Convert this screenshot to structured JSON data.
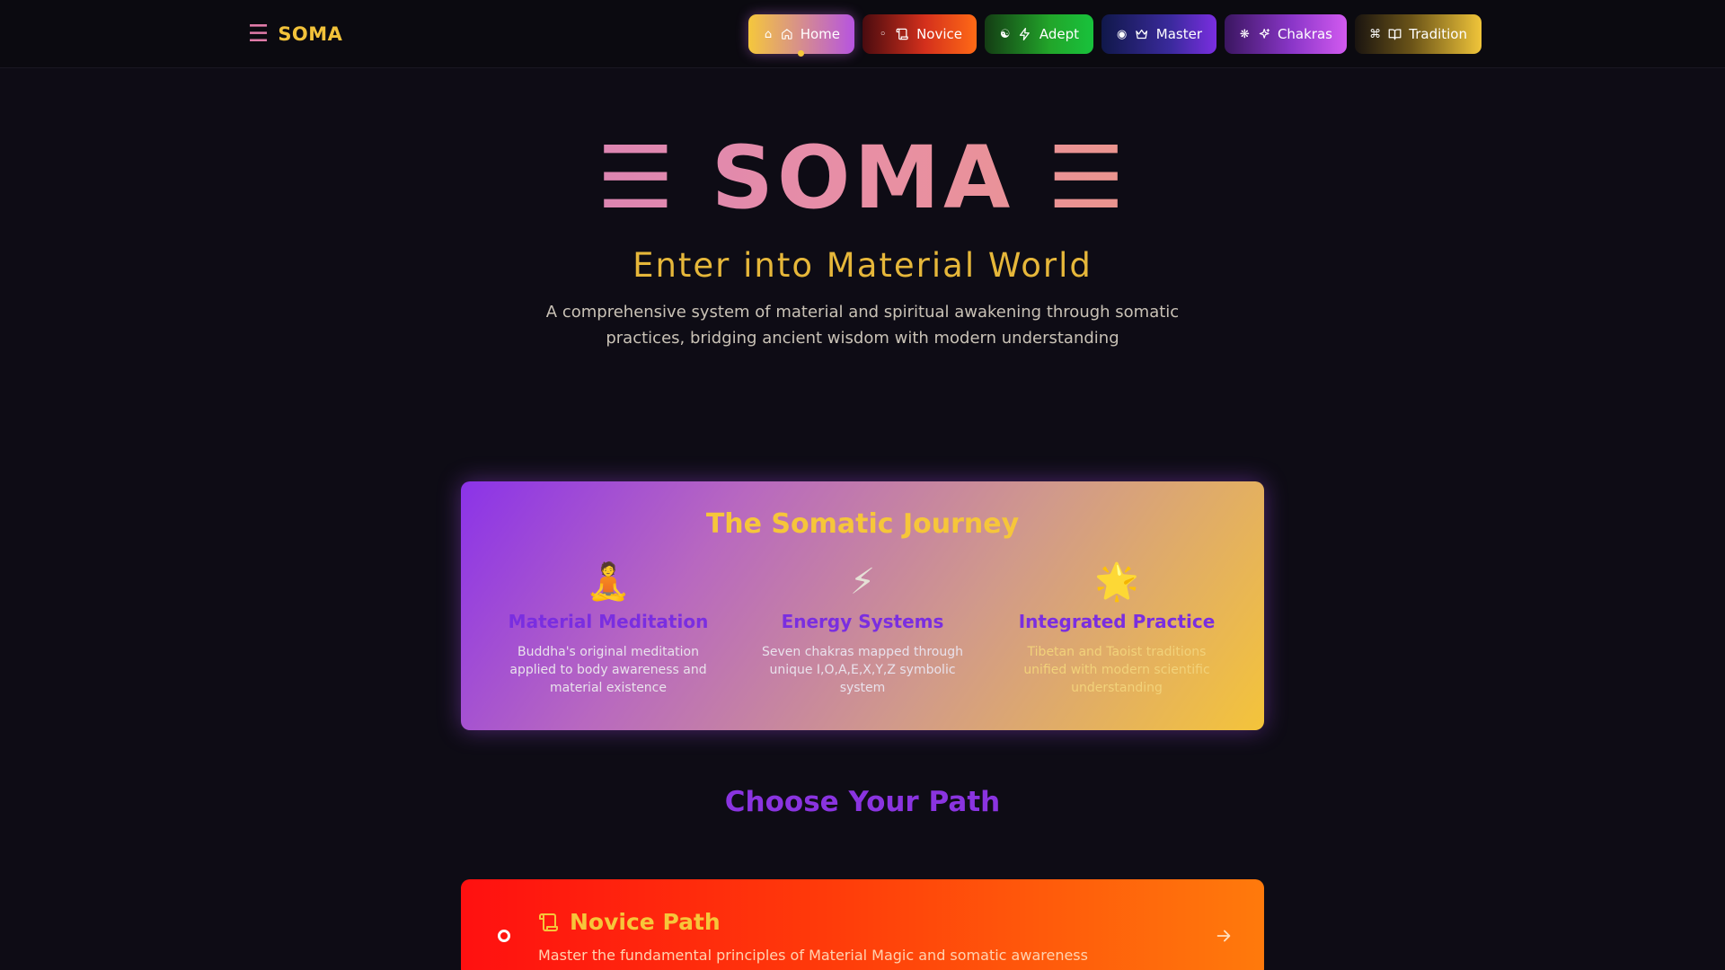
{
  "header": {
    "brand_icon": "☰",
    "brand_name": "SOMA",
    "nav": [
      {
        "symbol": "⌂",
        "icon": "home-icon",
        "label": "Home",
        "active": true
      },
      {
        "symbol": "◦",
        "icon": "scroll-icon",
        "label": "Novice"
      },
      {
        "symbol": "☯",
        "icon": "zap-icon",
        "label": "Adept"
      },
      {
        "symbol": "◉",
        "icon": "crown-icon",
        "label": "Master"
      },
      {
        "symbol": "❋",
        "icon": "sparkles-icon",
        "label": "Chakras"
      },
      {
        "symbol": "⌘",
        "icon": "book-open-icon",
        "label": "Tradition"
      }
    ]
  },
  "hero": {
    "title": "☰ SOMA ☰",
    "subtitle": "Enter into Material World",
    "description": "A comprehensive system of material and spiritual awakening through somatic practices, bridging ancient wisdom with modern understanding"
  },
  "journey": {
    "title": "The Somatic Journey",
    "pillars": [
      {
        "emoji": "🧘",
        "title": "Material Meditation",
        "text": "Buddha's original meditation applied to body awareness and material existence"
      },
      {
        "emoji": "⚡",
        "title": "Energy Systems",
        "text": "Seven chakras mapped through unique I,O,A,E,X,Y,Z symbolic system"
      },
      {
        "emoji": "🌟",
        "title": "Integrated Practice",
        "text": "Tibetan and Taoist traditions unified with modern scientific understanding"
      }
    ]
  },
  "paths": {
    "heading": "Choose Your Path",
    "cards": [
      {
        "icon": "scroll-icon",
        "title": "Novice Path",
        "description": "Master the fundamental principles of Material Magic and somatic awareness"
      }
    ]
  },
  "colors": {
    "background": "#0e0c15",
    "gold": "#f2c23a",
    "purple": "#8a34e0",
    "pink": "#e07aa8"
  }
}
